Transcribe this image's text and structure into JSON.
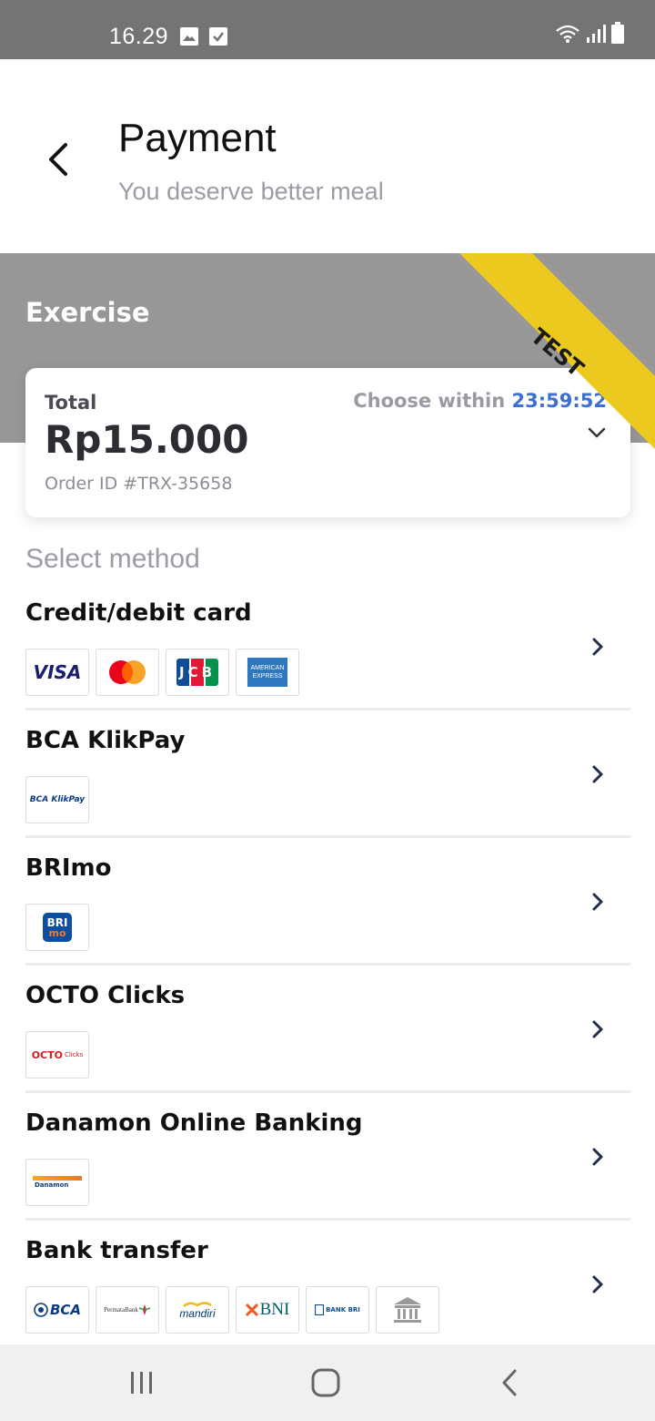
{
  "status_bar": {
    "time": "16.29",
    "left_icons": [
      "image-icon",
      "checkbox-icon"
    ],
    "right_icons": [
      "wifi-icon",
      "signal-icon",
      "battery-icon"
    ]
  },
  "header": {
    "title": "Payment",
    "subtitle": "You deserve better meal",
    "back_icon": "chevron-left-icon"
  },
  "merchant": {
    "name": "Exercise",
    "ribbon": "TEST",
    "ribbon_color": "#ebc91e",
    "band_color": "#979797"
  },
  "summary": {
    "total_label": "Total",
    "amount": "Rp15.000",
    "order_id": "Order ID #TRX-35658",
    "choose_label": "Choose within",
    "countdown": "23:59:52",
    "countdown_color": "#3d6fd0",
    "expand_icon": "chevron-down-icon"
  },
  "methods_section": {
    "heading": "Select method",
    "items": [
      {
        "name": "Credit/debit card",
        "logos": [
          "VISA",
          "Mastercard",
          "JCB",
          "AMERICAN EXPRESS"
        ]
      },
      {
        "name": "BCA KlikPay",
        "logos": [
          "BCA KlikPay"
        ]
      },
      {
        "name": "BRImo",
        "logos": [
          "BRI mo"
        ]
      },
      {
        "name": "OCTO Clicks",
        "logos": [
          "OCTO Clicks"
        ]
      },
      {
        "name": "Danamon Online Banking",
        "logos": [
          "Danamon"
        ]
      },
      {
        "name": "Bank transfer",
        "logos": [
          "BCA",
          "PermataBank",
          "mandiri",
          "BNI",
          "BANK BRI",
          "bank-building-icon"
        ]
      }
    ]
  },
  "logo_text": {
    "visa": "VISA",
    "jcb": "JCB",
    "amex_1": "AMERICAN",
    "amex_2": "EXPRESS",
    "bca_klikpay": "BCA KlikPay",
    "bri": "BRI",
    "mo": "mo",
    "octo": "OCTO",
    "octo_clicks": "Clicks",
    "danamon": "Danamon",
    "bca": "BCA",
    "permata": "PermataBank",
    "mandiri": "mandiri",
    "bni": "BNI",
    "bank_bri": "BANK BRI"
  },
  "nav_bar": {
    "buttons": [
      "recent-apps-icon",
      "home-icon",
      "back-icon"
    ]
  }
}
